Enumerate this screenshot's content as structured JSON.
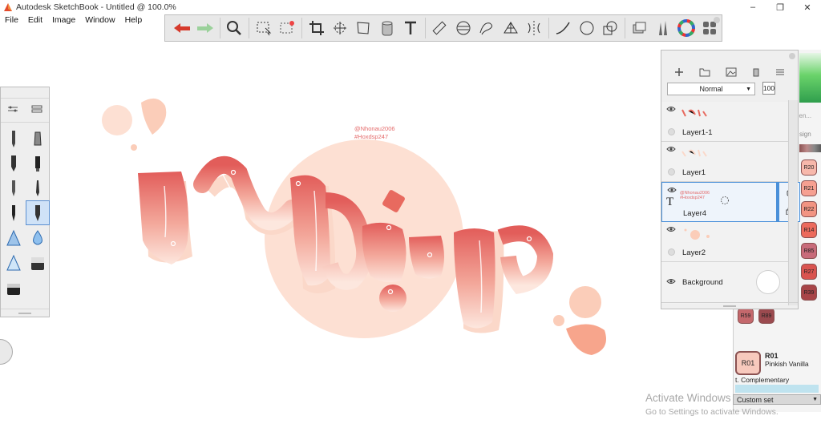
{
  "window": {
    "title": "Autodesk SketchBook - Untitled @ 100.0%",
    "controls": {
      "minimize": "–",
      "maximize": "❐",
      "close": "✕"
    }
  },
  "menu": [
    "File",
    "Edit",
    "Image",
    "Window",
    "Help"
  ],
  "toolbar": {
    "tools": [
      "undo-icon",
      "redo-icon",
      "zoom-icon",
      "select-icon",
      "lasso-select-icon",
      "crop-icon",
      "transform-icon",
      "distort-icon",
      "fill-icon",
      "text-icon",
      "ruler-icon",
      "ellipse-guide-icon",
      "french-curve-icon",
      "perspective-icon",
      "symmetry-icon",
      "stroke-icon",
      "shape-icon",
      "copic-icon",
      "layers-icon",
      "brush-library-icon",
      "color-wheel-icon",
      "palettes-icon"
    ]
  },
  "canvas": {
    "signature_line1": "@Nhonau2006",
    "signature_line2": "#Hoxdsp247",
    "colors": {
      "ribbon_top": "#e25d5a",
      "ribbon_bottom": "#fde7de",
      "shadow": "#fbd8c9",
      "circle": "#fde0d3",
      "drops_light": "#fbcdb9",
      "drops_dark": "#f7a58c"
    }
  },
  "layers_panel": {
    "blend_mode": "Normal",
    "opacity": "100",
    "layers": [
      {
        "name": "Layer1-1",
        "active": false
      },
      {
        "name": "Layer1",
        "active": false
      },
      {
        "name": "Layer4",
        "active": true,
        "thumb_text_1": "@Nhonau2006",
        "thumb_text_2": "#Hoxdsp247",
        "type_label": "T"
      },
      {
        "name": "Layer2",
        "active": false
      }
    ],
    "background_label": "Background"
  },
  "color_panel": {
    "partial_text_1": "llen...",
    "partial_text_2": "sign",
    "swatches": [
      "R20",
      "R21",
      "R22",
      "R14",
      "R85",
      "R27",
      "R39",
      "R59",
      "R89"
    ],
    "current_code": "R01",
    "current_name_code": "R01",
    "current_name": "Pinkish Vanilla",
    "complementary_label": "t. Complementary",
    "custom_set_label": "Custom set"
  },
  "activation": {
    "title": "Activate Windows",
    "subtitle": "Go to Settings to activate Windows."
  }
}
